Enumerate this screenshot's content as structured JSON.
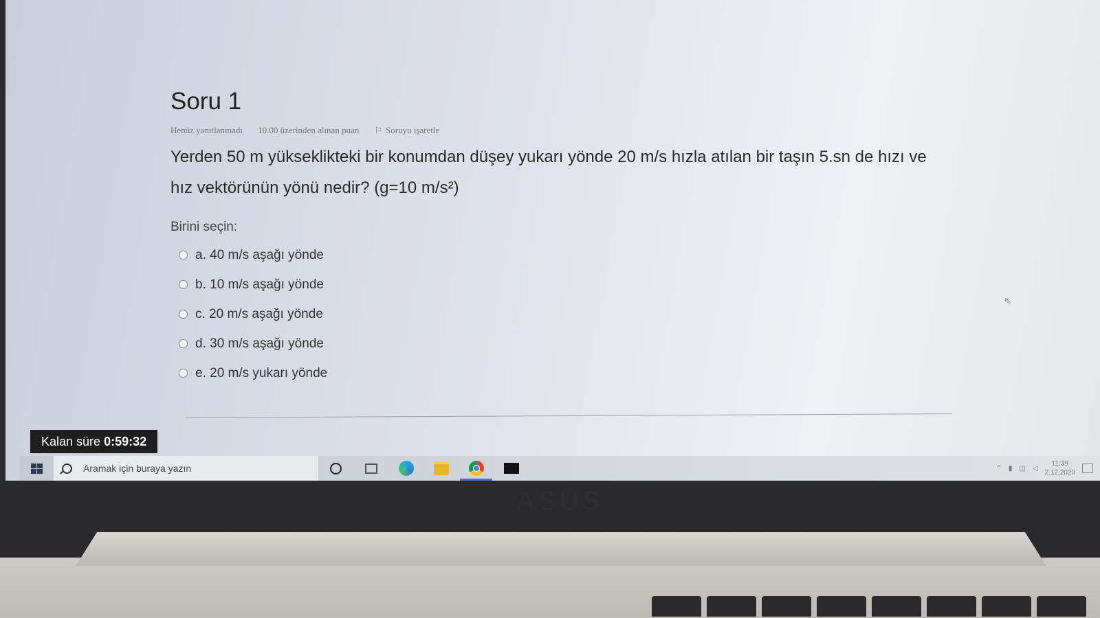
{
  "question": {
    "title": "Soru 1",
    "status": "Henüz yanıtlanmadı",
    "points": "10.00 üzerinden alınan puan",
    "flag_label": "Soruyu işaretle",
    "text": "Yerden 50 m yükseklikteki bir konumdan düşey yukarı yönde 20 m/s hızla atılan bir taşın 5.sn de hızı ve hız vektörünün yönü nedir? (g=10 m/s²)",
    "prompt": "Birini seçin:",
    "options": [
      "a. 40 m/s aşağı yönde",
      "b. 10 m/s aşağı yönde",
      "c. 20 m/s aşağı yönde",
      "d. 30 m/s aşağı yönde",
      "e. 20 m/s yukarı yönde"
    ]
  },
  "timer": {
    "label": "Kalan süre",
    "value": "0:59:32"
  },
  "taskbar": {
    "search_placeholder": "Aramak için buraya yazın",
    "apps": [
      "cortana-icon",
      "task-view-icon",
      "edge-icon",
      "file-explorer-icon",
      "chrome-icon",
      "terminal-icon"
    ],
    "active_app": "chrome-icon",
    "clock_time": "11:39",
    "clock_date": "2.12.2020"
  },
  "laptop": {
    "brand": "ASUS"
  },
  "colors": {
    "timer_bg": "#1e1e1e",
    "active_indicator": "#4a6fd8"
  }
}
